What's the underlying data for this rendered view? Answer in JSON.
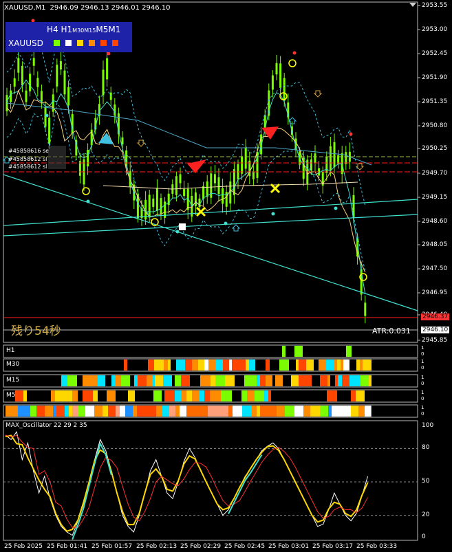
{
  "header": {
    "symbol_tf": "XAUUSD,M1",
    "ohlc": "2946.09 2946.13 2946.01 2946.10"
  },
  "tf_panel": {
    "timeframes": [
      "H4",
      "H1",
      "M30",
      "M15",
      "M5",
      "M1"
    ],
    "symbol": "XAUUSD",
    "colors": [
      "#7cfc00",
      "#ffffff",
      "#ffd700",
      "#ff8c00",
      "#ff4500",
      "#ff4500"
    ]
  },
  "price_axis": {
    "ticks": [
      "2953.55",
      "2953.00",
      "2952.45",
      "2951.90",
      "2951.35",
      "2950.80",
      "2950.25",
      "2949.70",
      "2949.15",
      "2948.60",
      "2948.05",
      "2947.50",
      "2946.95",
      "2946.40",
      "2946.10",
      "2945.85"
    ],
    "current_price": "2946.10",
    "bid_marker": "2946.37"
  },
  "order_labels": [
    "#45858616 se",
    "#45858612 sl",
    "#45858612 sl"
  ],
  "countdown": "残り54秒",
  "atr_label": "ATR:0.031",
  "mtf_panels": [
    {
      "label": "H1",
      "scale_top": "1",
      "scale_bottom": "0"
    },
    {
      "label": "M30",
      "scale_top": "1",
      "scale_bottom": "0"
    },
    {
      "label": "M15",
      "scale_top": "1",
      "scale_bottom": "0"
    },
    {
      "label": "M5",
      "scale_top": "1",
      "scale_bottom": "0"
    },
    {
      "label": "",
      "scale_top": "1",
      "scale_bottom": "0"
    }
  ],
  "oscillator": {
    "title": "MAX_Oscillator 22 29 2 35",
    "levels": [
      "100",
      "80",
      "50",
      "20",
      "0"
    ]
  },
  "time_axis": [
    "25 Feb 2025",
    "25 Feb 01:41",
    "25 Feb 01:57",
    "25 Feb 02:13",
    "25 Feb 02:29",
    "25 Feb 02:45",
    "25 Feb 03:01",
    "25 Feb 03:17",
    "25 Feb 03:33"
  ],
  "colors": {
    "candle": "#7cfc00",
    "trendline": "#40e0d0",
    "grid": "#808080",
    "sell_line": "#ff0000",
    "accent_yellow": "#ffff00"
  }
}
